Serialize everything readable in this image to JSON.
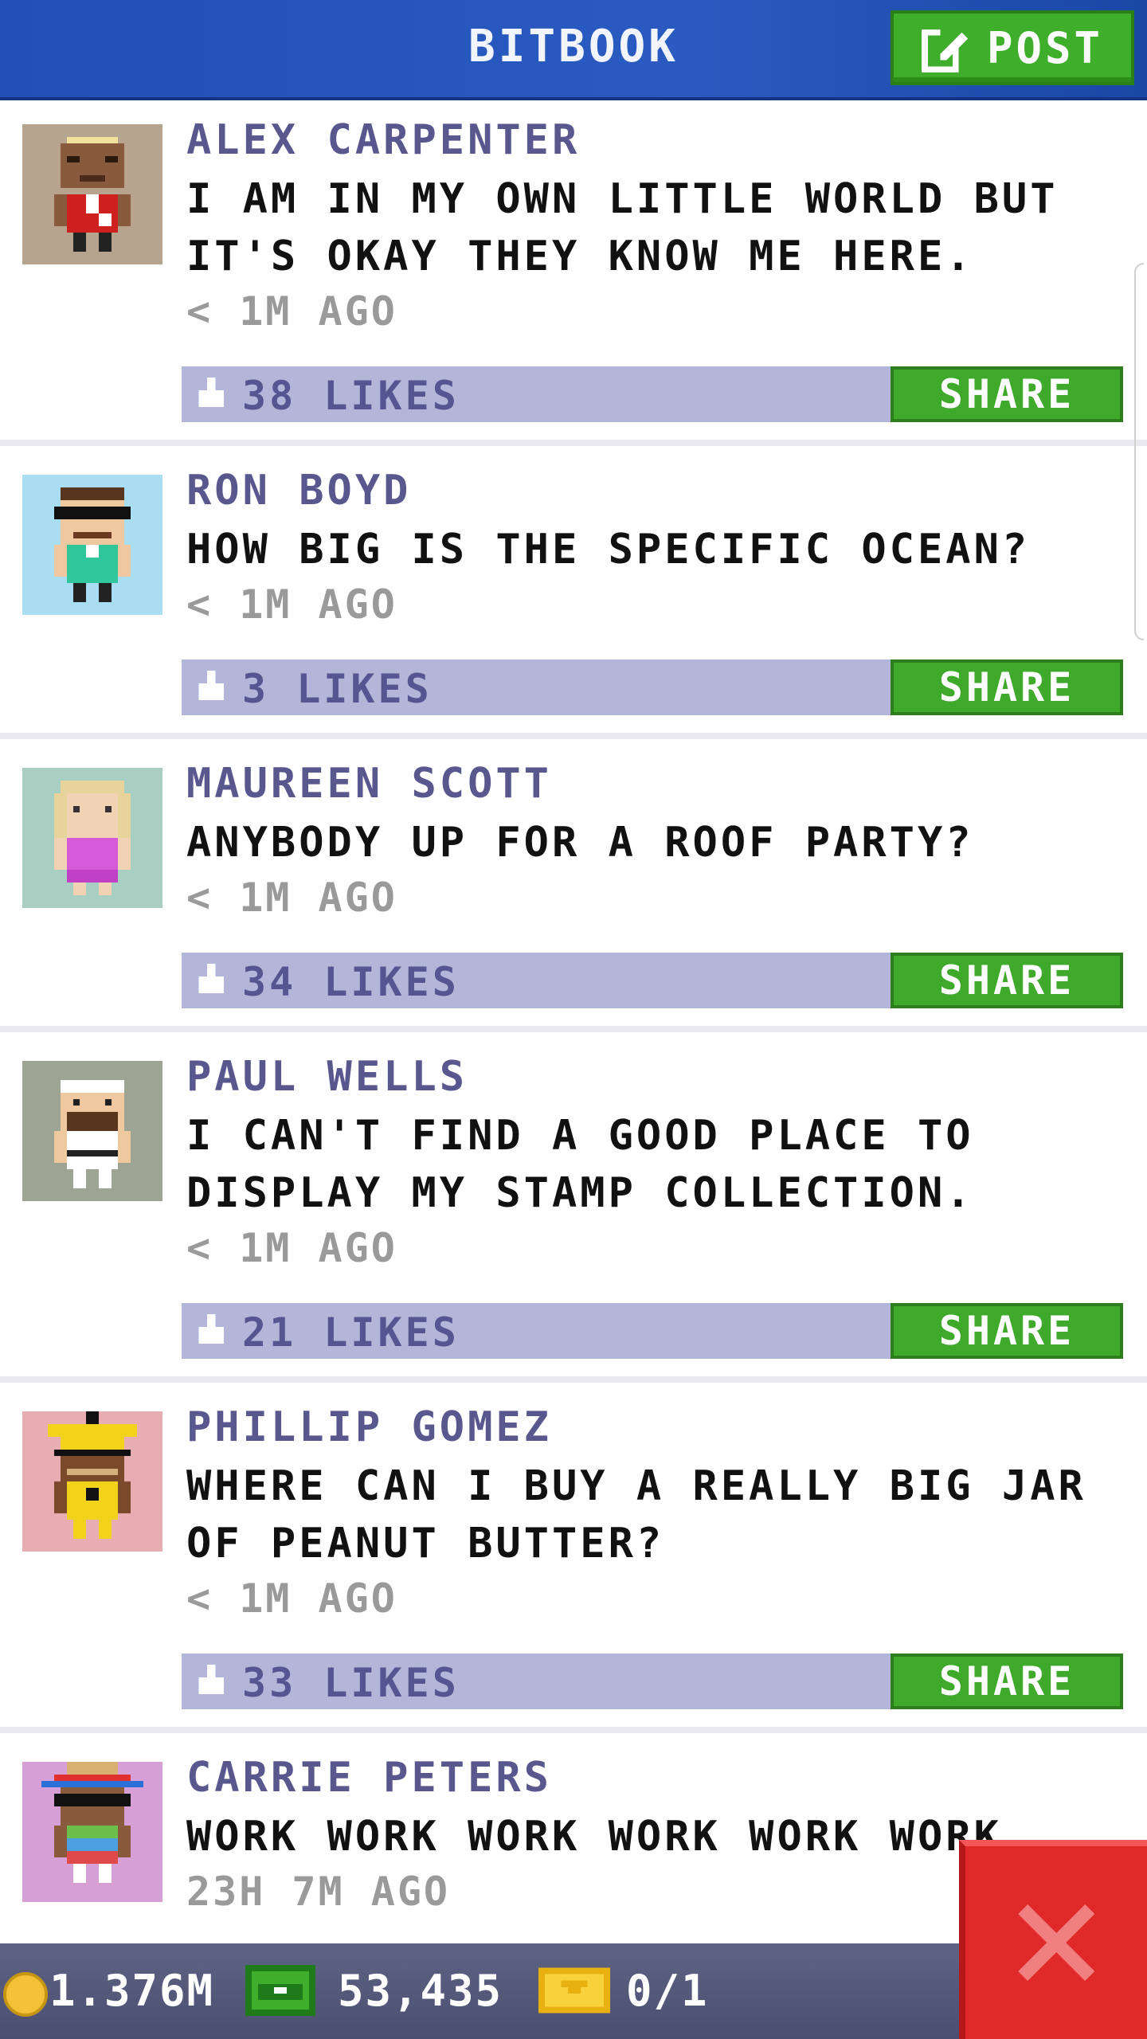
{
  "header": {
    "title": "BITBOOK",
    "post_label": "POST"
  },
  "posts": [
    {
      "name": "ALEX CARPENTER",
      "message": "I AM IN MY OWN LITTLE WORLD BUT IT'S OKAY THEY KNOW ME HERE.",
      "time": "< 1M AGO",
      "likes": "38 LIKES",
      "share": "SHARE"
    },
    {
      "name": "RON BOYD",
      "message": "HOW BIG IS THE SPECIFIC OCEAN?",
      "time": "< 1M AGO",
      "likes": "3 LIKES",
      "share": "SHARE"
    },
    {
      "name": "MAUREEN SCOTT",
      "message": "ANYBODY UP FOR A ROOF PARTY?",
      "time": "< 1M AGO",
      "likes": "34 LIKES",
      "share": "SHARE"
    },
    {
      "name": "PAUL WELLS",
      "message": "I CAN'T FIND A GOOD PLACE TO DISPLAY MY STAMP COLLECTION.",
      "time": "< 1M AGO",
      "likes": "21 LIKES",
      "share": "SHARE"
    },
    {
      "name": "PHILLIP GOMEZ",
      "message": "WHERE CAN I BUY A REALLY BIG JAR OF PEANUT BUTTER?",
      "time": "< 1M AGO",
      "likes": "33 LIKES",
      "share": "SHARE"
    },
    {
      "name": "CARRIE PETERS",
      "message": "WORK WORK WORK WORK WORK WORK",
      "time": "23H 7M AGO"
    }
  ],
  "bottom_bar": {
    "coins": "1.376M",
    "bux": "53,435",
    "tickets": "0/1"
  },
  "icons": {
    "post": "edit-icon",
    "like": "thumbs-up-icon",
    "coin": "coin-icon",
    "bux": "bux-icon",
    "ticket": "ticket-icon",
    "close": "close-icon"
  }
}
